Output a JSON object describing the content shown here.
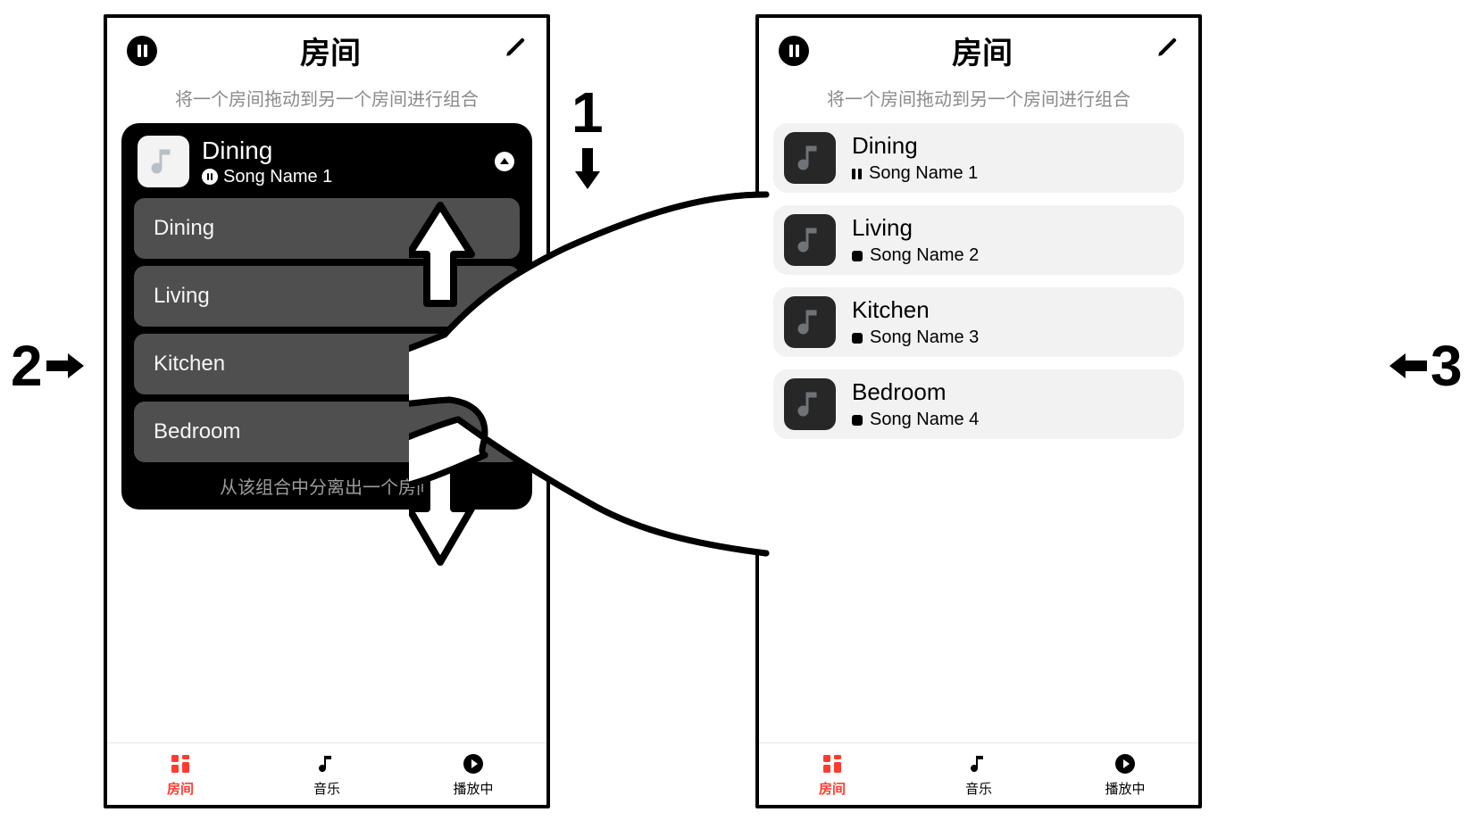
{
  "callouts": {
    "one": "1",
    "two": "2",
    "three": "3"
  },
  "shared": {
    "header_title": "房间",
    "drag_hint": "将一个房间拖动到另一个房间进行组合",
    "tabs": {
      "rooms": "房间",
      "music": "音乐",
      "playing": "播放中"
    }
  },
  "left": {
    "group": {
      "title": "Dining",
      "song": "Song Name 1",
      "rooms": [
        {
          "name": "Dining"
        },
        {
          "name": "Living"
        },
        {
          "name": "Kitchen"
        },
        {
          "name": "Bedroom"
        }
      ],
      "separate_hint": "从该组合中分离出一个房间"
    }
  },
  "right": {
    "rooms": [
      {
        "name": "Dining",
        "song": "Song Name 1",
        "state": "paused"
      },
      {
        "name": "Living",
        "song": "Song Name 2",
        "state": "stopped"
      },
      {
        "name": "Kitchen",
        "song": "Song Name 3",
        "state": "stopped"
      },
      {
        "name": "Bedroom",
        "song": "Song Name 4",
        "state": "stopped"
      }
    ]
  }
}
